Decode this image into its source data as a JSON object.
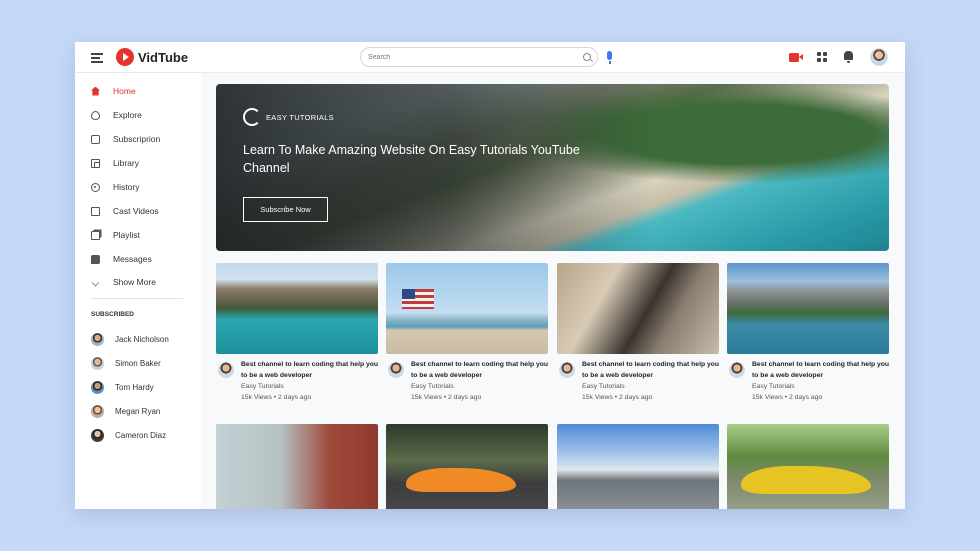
{
  "app": {
    "name": "VidTube"
  },
  "header": {
    "search_placeholder": "Search"
  },
  "sidebar": {
    "items": [
      {
        "label": "Home",
        "icon": "home-icon",
        "active": true
      },
      {
        "label": "Explore",
        "icon": "explore-icon"
      },
      {
        "label": "Subscriprion",
        "icon": "subscription-icon"
      },
      {
        "label": "Library",
        "icon": "library-icon"
      },
      {
        "label": "History",
        "icon": "history-icon"
      },
      {
        "label": "Cast Videos",
        "icon": "cast-icon"
      },
      {
        "label": "Playlist",
        "icon": "playlist-icon"
      },
      {
        "label": "Messages",
        "icon": "messages-icon"
      },
      {
        "label": "Show More",
        "icon": "chevron-down-icon"
      }
    ],
    "subscribed_heading": "SUBSCRIBED",
    "subscribed": [
      {
        "name": "Jack Nicholson"
      },
      {
        "name": "Simon Baker"
      },
      {
        "name": "Tom Hardy"
      },
      {
        "name": "Megan Ryan"
      },
      {
        "name": "Cameron Diaz"
      }
    ]
  },
  "banner": {
    "brand": "EASY TUTORIALS",
    "title": "Learn To Make Amazing Website On Easy Tutorials YouTube Channel",
    "button_label": "Subscribe Now"
  },
  "videos": [
    {
      "title": "Best channel to learn coding that help you to be a web developer",
      "channel": "Easy Tutorials",
      "stats": "15k Views • 2 days ago"
    },
    {
      "title": "Best channel to learn coding that help you to be a web developer",
      "channel": "Easy Tutorials",
      "stats": "15k Views • 2 days ago"
    },
    {
      "title": "Best channel to learn coding that help you to be a web developer",
      "channel": "Easy Tutorials",
      "stats": "15k Views • 2 days ago"
    },
    {
      "title": "Best channel to learn coding that help you to be a web developer",
      "channel": "Easy Tutorials",
      "stats": "15k Views • 2 days ago"
    }
  ],
  "colors": {
    "accent": "#e3342f",
    "mic": "#3d7ae8",
    "background": "#c5d8f7"
  }
}
